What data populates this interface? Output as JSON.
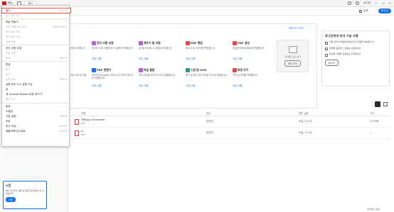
{
  "titlebar": {
    "menu_label": "메뉴",
    "tab_label": "홈",
    "tab_label2": "문서",
    "right_text": "로그인",
    "window_controls": [
      "—",
      "☐",
      "✕"
    ]
  },
  "appbar": {
    "search_label": "검색",
    "signin_label": "로그인"
  },
  "tools": {
    "title": "권장 도구",
    "more": "모든 도구 보기",
    "items": [
      {
        "name": "주석 추가",
        "desc": "메모, 강조 표시 및 기타 주석을 추가합니다.",
        "use": "지금 사용",
        "color": "#f5a623"
      },
      {
        "name": "전자 서명 요청",
        "desc": "문서를 보내 서명을 받고 상태를 추적합니다.",
        "use": "지금 사용",
        "color": "#b660e0"
      },
      {
        "name": "채우기 및 서명",
        "desc": "양식을 작성하고 서명을 추가합니다.",
        "use": "지금 사용",
        "color": "#b660e0"
      },
      {
        "name": "PDF 편집",
        "desc": "텍스트 및 이미지를 편집합니다.",
        "use": "지금 사용",
        "color": "#e34850"
      },
      {
        "name": "PDF 생성",
        "desc": "파일을 PDF로 빠르게 변환합니다.",
        "use": "지금 사용",
        "color": "#e34850"
      },
      {
        "name": "PDF 내보내기",
        "desc": "PDF를 Microsoft Office 파일 등으로 변환합니다.",
        "use": "지금 사용",
        "color": "#2d9d78"
      },
      {
        "name": "PDF 변환기",
        "desc": "PDF를 Microsoft Office 및 이미지 형식으로 변환합니다.",
        "use": "지금 사용",
        "color": "#1473e6"
      },
      {
        "name": "파일 결합",
        "desc": "여러 파일을 하나의 PDF로 결합합니다.",
        "use": "지금 사용",
        "color": "#b660e0"
      },
      {
        "name": "스캔 및 OCR",
        "desc": "종이 문서를 검색 가능한 PDF로 변환합니다.",
        "use": "지금 사용",
        "color": "#2d9d78"
      },
      {
        "name": "측정 도구",
        "desc": "거리 및 면적을 측정합니다.",
        "use": "지금 사용",
        "color": "#e34850"
      }
    ],
    "promo_text": "더 많은 도구 보기",
    "promo_button": "모두 보기"
  },
  "signin_panel": {
    "title": "로그인하여 추가 기능 사용",
    "items": [
      "다른 장치의 파일에 액세스하고 작업을 계속합니다.",
      "파일을 공유하고 검토를 요청합니다.",
      "문서에 서명을 요청하고 추적합니다."
    ],
    "button": "로그인"
  },
  "files": {
    "headers": [
      "이름",
      "공유",
      "열린 날짜",
      "크기"
    ],
    "rows": [
      {
        "name": "TRB Joy of Summer",
        "type": "PDF",
        "owner": "본인만",
        "date": "오늘, 10:20",
        "size": "1.6 MB"
      },
      {
        "name": "A",
        "type": "PDF",
        "owner": "본인만",
        "date": "오늘, 11:24",
        "size": "—"
      }
    ]
  },
  "scan_card": {
    "title": "스캔",
    "desc": "PDF 및 전자 서명 도구에 무료 액세스할 수 있습니다.",
    "button": "스캔"
  },
  "footer": "개인정보 설정",
  "menu": {
    "items": [
      {
        "label": "열기...",
        "shortcut": "Ctrl+O",
        "disabled": false,
        "highlight": true
      },
      {
        "label": "다시 열기 탭",
        "shortcut": "",
        "disabled": true
      },
      {
        "label": "파일 만들기",
        "shortcut": "",
        "disabled": false,
        "arrow": true
      },
      {
        "label": "다른 이름으로 저장...",
        "shortcut": "Shift+Ctrl+S",
        "disabled": true
      },
      {
        "label": "Word로 저장",
        "shortcut": "",
        "disabled": true
      },
      {
        "label": "텍스트로 저장...",
        "shortcut": "",
        "disabled": true
      },
      {
        "label": "인쇄 준비",
        "shortcut": "",
        "disabled": true
      },
      {
        "label": "전자 서명 요청",
        "shortcut": "",
        "disabled": false
      },
      {
        "label": "파일 보호",
        "shortcut": "",
        "disabled": true
      },
      {
        "label": "인쇄...",
        "shortcut": "Ctrl+P",
        "disabled": true
      },
      {
        "label": "편집",
        "shortcut": "",
        "disabled": false,
        "arrow": true
      },
      {
        "label": "보기",
        "shortcut": "",
        "disabled": true,
        "arrow": true
      },
      {
        "label": "문서",
        "shortcut": "",
        "disabled": true,
        "arrow": true
      },
      {
        "label": "실행 취소",
        "shortcut": "Ctrl+Z",
        "disabled": true
      },
      {
        "label": "실행 취소 다시 실행 기능",
        "shortcut": "",
        "disabled": false
      },
      {
        "label": "창",
        "shortcut": "",
        "disabled": false,
        "arrow": true
      },
      {
        "label": "새 Acrobat Reader 버튼 바꾸기",
        "shortcut": "",
        "disabled": false
      },
      {
        "label": "플러그인",
        "shortcut": "",
        "disabled": true
      },
      {
        "label": "환경",
        "shortcut": "",
        "disabled": false,
        "arrow": true
      },
      {
        "label": "도움말",
        "shortcut": "",
        "disabled": false,
        "arrow": true
      },
      {
        "label": "기본 설정...",
        "shortcut": "Ctrl+K",
        "disabled": false
      },
      {
        "label": "보호",
        "shortcut": "",
        "disabled": false,
        "arrow": true
      },
      {
        "label": "문서 속성...",
        "shortcut": "Ctrl+D",
        "disabled": false
      },
      {
        "label": "애플리케이션 종료",
        "shortcut": "Ctrl+Q",
        "disabled": false
      }
    ]
  }
}
